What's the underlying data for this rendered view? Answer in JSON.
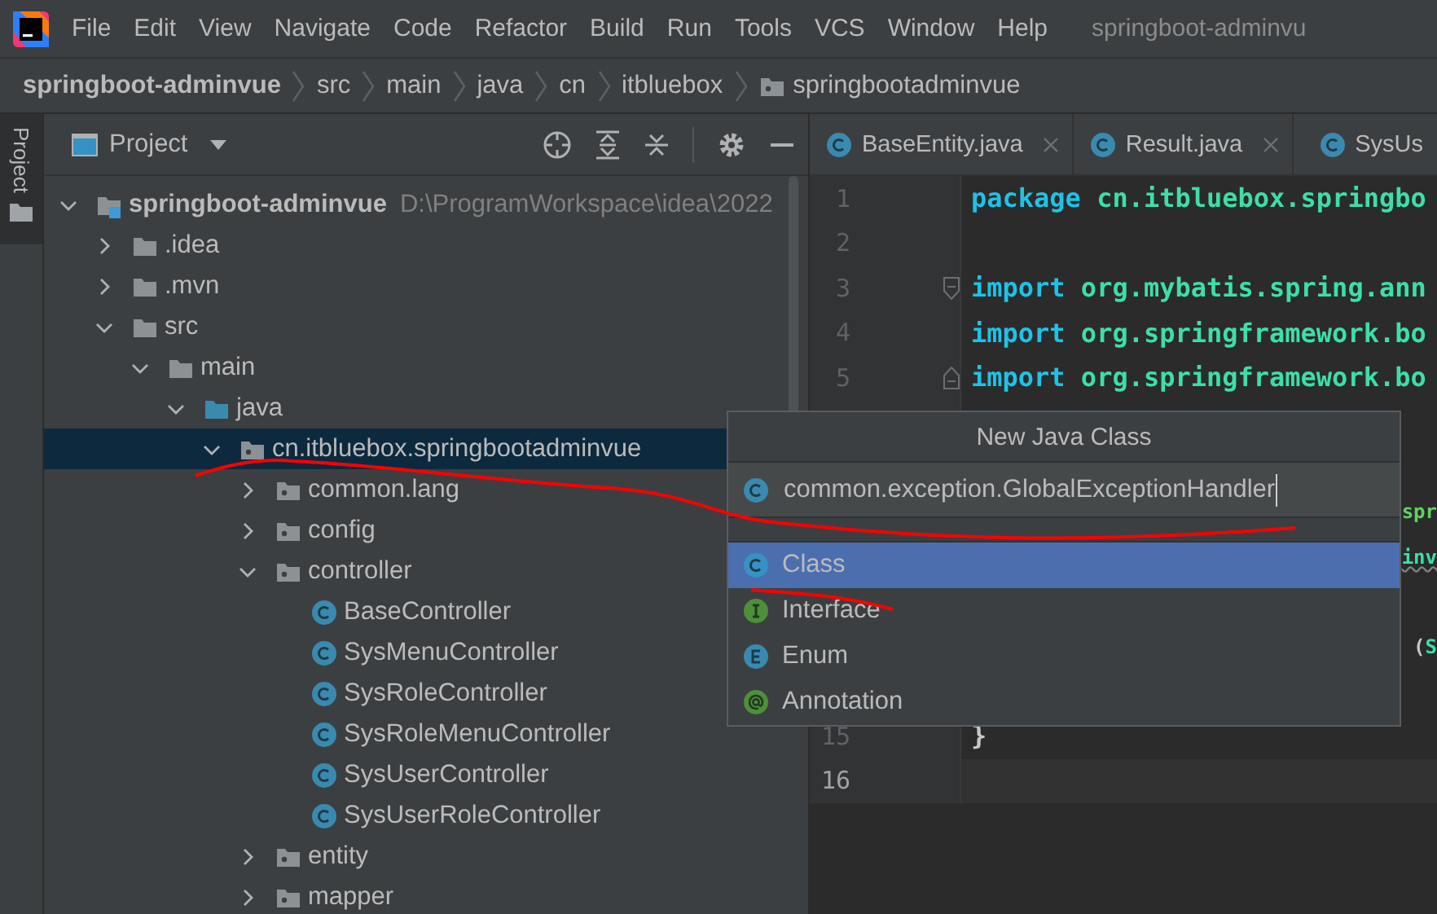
{
  "menu_bar": {
    "items": [
      "File",
      "Edit",
      "View",
      "Navigate",
      "Code",
      "Refactor",
      "Build",
      "Run",
      "Tools",
      "VCS",
      "Window",
      "Help"
    ],
    "title": "springboot-adminvu"
  },
  "breadcrumbs": [
    {
      "label": "springboot-adminvue",
      "kind": "project"
    },
    {
      "label": "src",
      "kind": "plain"
    },
    {
      "label": "main",
      "kind": "plain"
    },
    {
      "label": "java",
      "kind": "plain"
    },
    {
      "label": "cn",
      "kind": "plain"
    },
    {
      "label": "itbluebox",
      "kind": "plain"
    },
    {
      "label": "springbootadminvue",
      "kind": "package"
    }
  ],
  "tool_strip": {
    "label": "Project",
    "selected": true
  },
  "project_panel": {
    "title": "Project",
    "tree": [
      {
        "label": "springboot-adminvue",
        "kind": "module",
        "path": "D:\\ProgramWorkspace\\idea\\2022",
        "expanded": true,
        "selected": false,
        "children": [
          {
            "label": ".idea",
            "kind": "folder",
            "expanded": false,
            "selected": false
          },
          {
            "label": ".mvn",
            "kind": "folder",
            "expanded": false,
            "selected": false
          },
          {
            "label": "src",
            "kind": "folder",
            "expanded": true,
            "selected": false,
            "children": [
              {
                "label": "main",
                "kind": "folder",
                "expanded": true,
                "selected": false,
                "children": [
                  {
                    "label": "java",
                    "kind": "source",
                    "expanded": true,
                    "selected": false,
                    "children": [
                      {
                        "label": "cn.itbluebox.springbootadminvue",
                        "kind": "package",
                        "expanded": true,
                        "selected": true,
                        "children": [
                          {
                            "label": "common.lang",
                            "kind": "package",
                            "expanded": false,
                            "selected": false
                          },
                          {
                            "label": "config",
                            "kind": "package",
                            "expanded": false,
                            "selected": false
                          },
                          {
                            "label": "controller",
                            "kind": "package",
                            "expanded": true,
                            "selected": false,
                            "children": [
                              {
                                "label": "BaseController",
                                "kind": "class",
                                "selected": false
                              },
                              {
                                "label": "SysMenuController",
                                "kind": "class",
                                "selected": false
                              },
                              {
                                "label": "SysRoleController",
                                "kind": "class",
                                "selected": false
                              },
                              {
                                "label": "SysRoleMenuController",
                                "kind": "class",
                                "selected": false
                              },
                              {
                                "label": "SysUserController",
                                "kind": "class",
                                "selected": false
                              },
                              {
                                "label": "SysUserRoleController",
                                "kind": "class",
                                "selected": false
                              }
                            ]
                          },
                          {
                            "label": "entity",
                            "kind": "package",
                            "expanded": false,
                            "selected": false
                          },
                          {
                            "label": "mapper",
                            "kind": "package",
                            "expanded": false,
                            "selected": false
                          }
                        ]
                      }
                    ]
                  }
                ]
              }
            ]
          }
        ]
      }
    ]
  },
  "editor": {
    "tabs": [
      {
        "label": "BaseEntity.java",
        "selected": false,
        "close": true
      },
      {
        "label": "Result.java",
        "selected": false,
        "close": true
      },
      {
        "label": "SysUs",
        "selected": false,
        "close": false
      }
    ],
    "lines": [
      {
        "kind": "code",
        "number": "1",
        "tokens": [
          {
            "kind": "keyword",
            "text": "package"
          },
          {
            "kind": "ident",
            "text": " cn.itbluebox.springbo"
          }
        ]
      },
      {
        "kind": "code",
        "number": "2"
      },
      {
        "kind": "code",
        "number": "3",
        "fold_start": true,
        "tokens": [
          {
            "kind": "keyword",
            "text": "import"
          },
          {
            "kind": "ident",
            "text": " org.mybatis.spring.ann"
          }
        ]
      },
      {
        "kind": "code",
        "number": "4",
        "tokens": [
          {
            "kind": "keyword",
            "text": "import"
          },
          {
            "kind": "ident",
            "text": " org.springframework.bo"
          }
        ]
      },
      {
        "kind": "code",
        "number": "5",
        "fold_end": true,
        "tokens": [
          {
            "kind": "keyword",
            "text": "import"
          },
          {
            "kind": "ident",
            "text": " org.springframework.bo"
          }
        ]
      },
      {
        "kind": "hidden"
      },
      {
        "kind": "hidden"
      },
      {
        "kind": "fragment",
        "tokens": [
          {
            "kind": "annotation",
            "text": "spr"
          }
        ]
      },
      {
        "kind": "fragment",
        "tokens": [
          {
            "kind": "flagged",
            "text": "inv"
          }
        ]
      },
      {
        "kind": "hidden"
      },
      {
        "kind": "fragment",
        "tokens": [
          {
            "kind": "plain",
            "text": "("
          },
          {
            "kind": "ident",
            "text": "S"
          }
        ]
      },
      {
        "kind": "hidden"
      },
      {
        "kind": "code",
        "number": "15",
        "tokens": [
          {
            "kind": "plain",
            "text": "}"
          }
        ]
      },
      {
        "kind": "code",
        "number": "16",
        "current": true
      }
    ]
  },
  "new_class_popup": {
    "title": "New Java Class",
    "field_value": "common.exception.GlobalExceptionHandler",
    "options": [
      {
        "label": "Class",
        "kind": "class",
        "selected": true
      },
      {
        "label": "Interface",
        "kind": "interface",
        "selected": false
      },
      {
        "label": "Enum",
        "kind": "enum",
        "selected": false
      },
      {
        "label": "Annotation",
        "kind": "annotation",
        "selected": false
      }
    ]
  }
}
